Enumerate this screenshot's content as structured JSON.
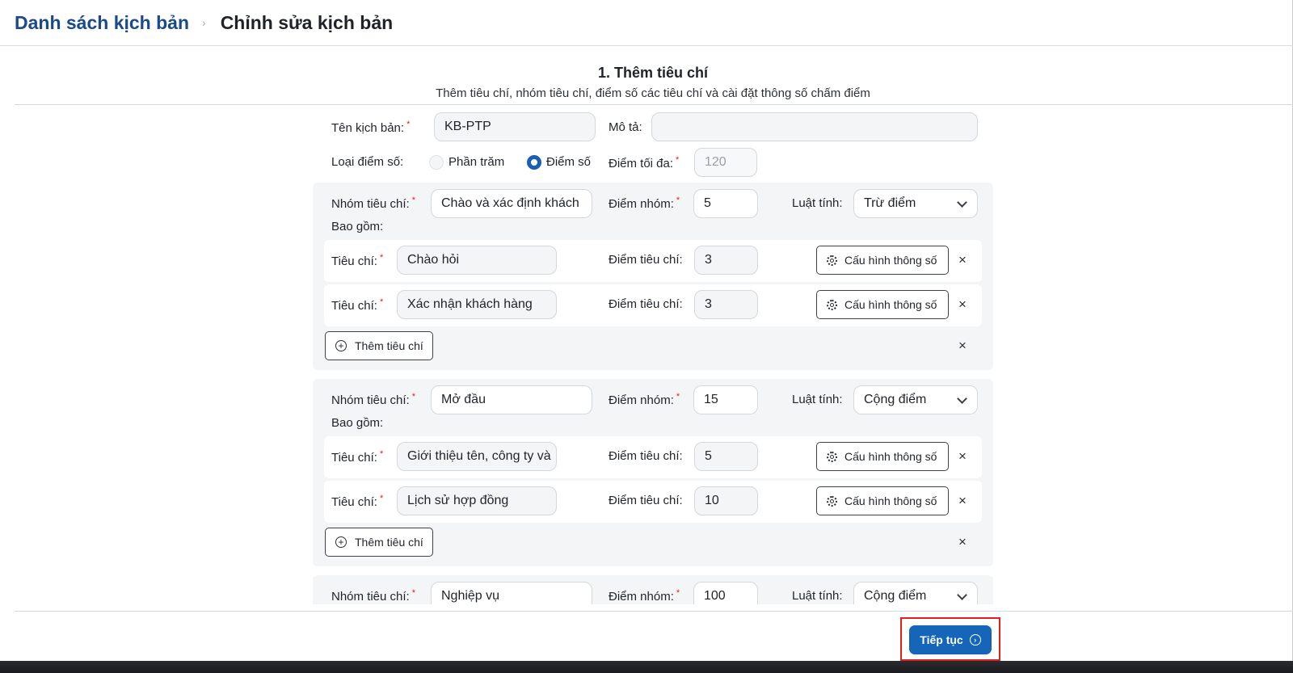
{
  "breadcrumb": {
    "parent": "Danh sách kịch bản",
    "separator": "›",
    "current": "Chỉnh sửa kịch bản"
  },
  "step": {
    "title": "1. Thêm tiêu chí",
    "subtitle": "Thêm tiêu chí, nhóm tiêu chí, điểm số các tiêu chí và cài đặt thông số chấm điểm"
  },
  "form": {
    "name_label": "Tên kịch bản:",
    "name_value": "KB-PTP",
    "desc_label": "Mô tả:",
    "desc_value": "",
    "score_type_label": "Loại điểm số:",
    "score_type_options": [
      "Phần trăm",
      "Điểm số"
    ],
    "score_type_selected": "Điểm số",
    "max_score_label": "Điểm tối đa:",
    "max_score_value": "120",
    "required_mark": "*"
  },
  "labels": {
    "group_name": "Nhóm tiêu chí:",
    "group_score": "Điểm nhóm:",
    "rule": "Luật tính:",
    "includes": "Bao gồm:",
    "criterion": "Tiêu chí:",
    "criterion_score": "Điểm tiêu chí:",
    "config_button": "Cấu hình thông số",
    "add_criterion_button": "Thêm tiêu chí",
    "close": "×"
  },
  "groups": [
    {
      "name": "Chào và xác định khách",
      "score": "5",
      "rule": "Trừ điểm",
      "criteria": [
        {
          "name": "Chào hỏi",
          "score": "3"
        },
        {
          "name": "Xác nhận khách hàng",
          "score": "3"
        }
      ]
    },
    {
      "name": "Mở đầu",
      "score": "15",
      "rule": "Cộng điểm",
      "criteria": [
        {
          "name": "Giới thiệu tên, công ty và",
          "score": "5"
        },
        {
          "name": "Lịch sử hợp đồng",
          "score": "10"
        }
      ]
    },
    {
      "name": "Nghiệp vụ",
      "score": "100",
      "rule": "Cộng điểm",
      "criteria": []
    }
  ],
  "footer": {
    "continue_label": "Tiếp tục"
  },
  "colors": {
    "primary": "#1565b8",
    "brand_dark": "#1a4a8a",
    "highlight": "#e32020"
  }
}
